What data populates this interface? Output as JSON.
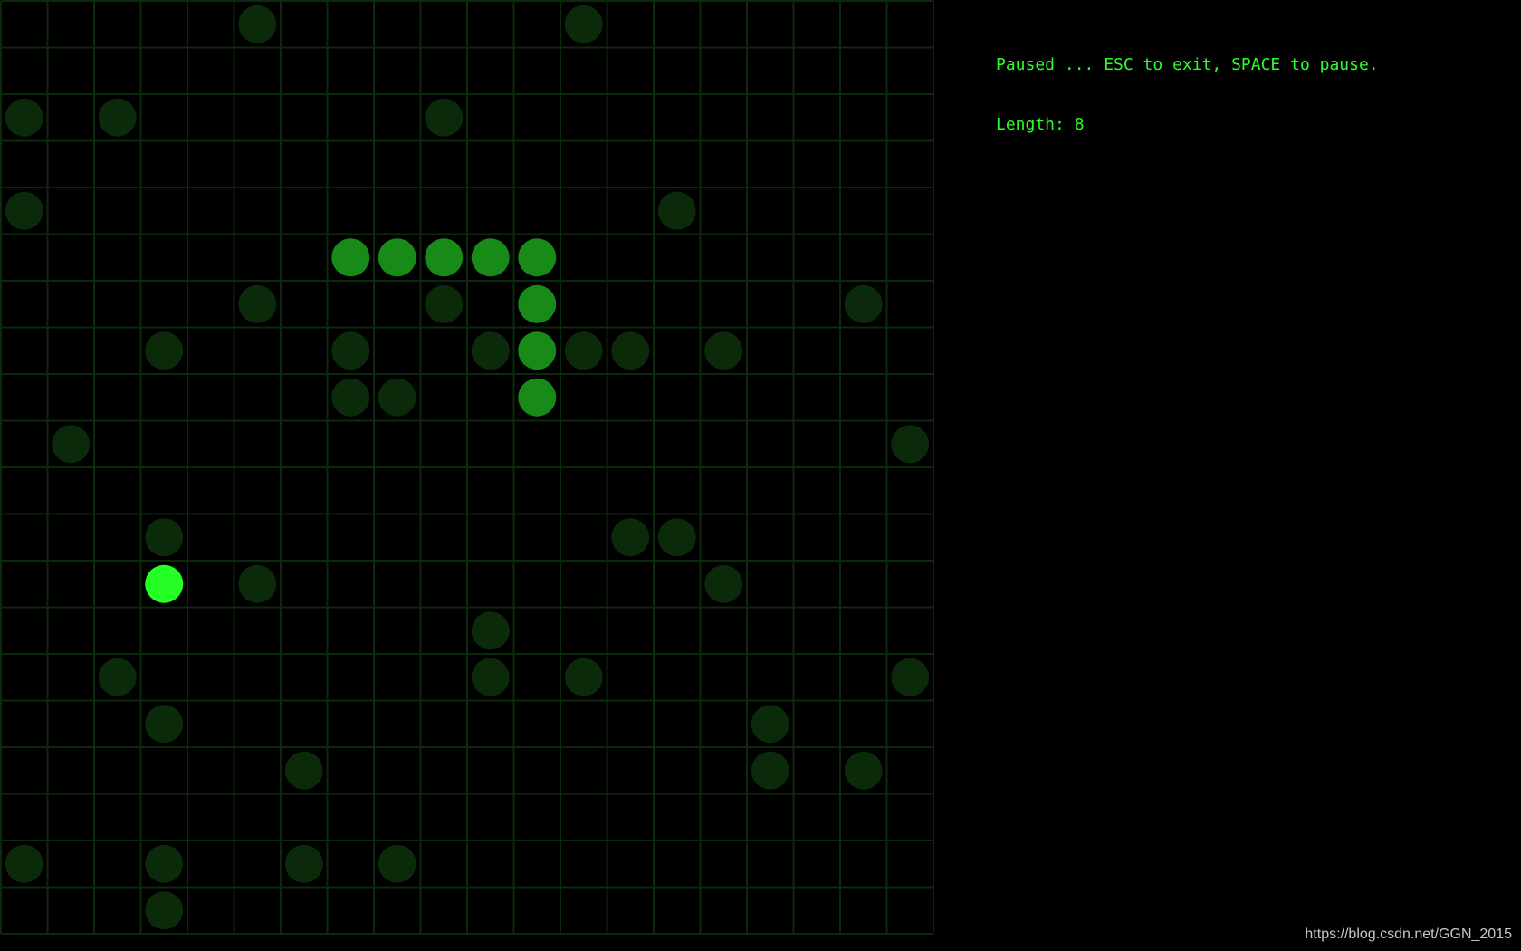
{
  "status": {
    "message": "Paused ... ESC to exit, SPACE to pause.",
    "length_text": "Length: 8"
  },
  "watermark": "https://blog.csdn.net/GGN_2015",
  "game": {
    "grid_cols": 20,
    "grid_rows": 20,
    "colors": {
      "background": "#000000",
      "grid_line": "#0b2a0b",
      "empty_dot": "#0a2a0a",
      "snake": "#178a17",
      "food": "#26ff26",
      "text": "#2aff2a"
    },
    "snake": [
      {
        "col": 11,
        "row": 8
      },
      {
        "col": 11,
        "row": 7
      },
      {
        "col": 11,
        "row": 6
      },
      {
        "col": 11,
        "row": 5
      },
      {
        "col": 10,
        "row": 5
      },
      {
        "col": 9,
        "row": 5
      },
      {
        "col": 8,
        "row": 5
      },
      {
        "col": 7,
        "row": 5
      }
    ],
    "food": {
      "col": 3,
      "row": 12
    },
    "dim_dots": [
      {
        "col": 5,
        "row": 0
      },
      {
        "col": 12,
        "row": 0
      },
      {
        "col": 0,
        "row": 2
      },
      {
        "col": 2,
        "row": 2
      },
      {
        "col": 9,
        "row": 2
      },
      {
        "col": 0,
        "row": 4
      },
      {
        "col": 14,
        "row": 4
      },
      {
        "col": 5,
        "row": 6
      },
      {
        "col": 9,
        "row": 6
      },
      {
        "col": 18,
        "row": 6
      },
      {
        "col": 3,
        "row": 7
      },
      {
        "col": 7,
        "row": 7
      },
      {
        "col": 10,
        "row": 7
      },
      {
        "col": 12,
        "row": 7
      },
      {
        "col": 13,
        "row": 7
      },
      {
        "col": 15,
        "row": 7
      },
      {
        "col": 7,
        "row": 8
      },
      {
        "col": 8,
        "row": 8
      },
      {
        "col": 1,
        "row": 9
      },
      {
        "col": 19,
        "row": 9
      },
      {
        "col": 3,
        "row": 11
      },
      {
        "col": 13,
        "row": 11
      },
      {
        "col": 14,
        "row": 11
      },
      {
        "col": 5,
        "row": 12
      },
      {
        "col": 15,
        "row": 12
      },
      {
        "col": 10,
        "row": 13
      },
      {
        "col": 2,
        "row": 14
      },
      {
        "col": 10,
        "row": 14
      },
      {
        "col": 12,
        "row": 14
      },
      {
        "col": 19,
        "row": 14
      },
      {
        "col": 3,
        "row": 15
      },
      {
        "col": 16,
        "row": 15
      },
      {
        "col": 6,
        "row": 16
      },
      {
        "col": 16,
        "row": 16
      },
      {
        "col": 18,
        "row": 16
      },
      {
        "col": 0,
        "row": 18
      },
      {
        "col": 3,
        "row": 18
      },
      {
        "col": 6,
        "row": 18
      },
      {
        "col": 8,
        "row": 18
      },
      {
        "col": 3,
        "row": 19
      }
    ]
  }
}
